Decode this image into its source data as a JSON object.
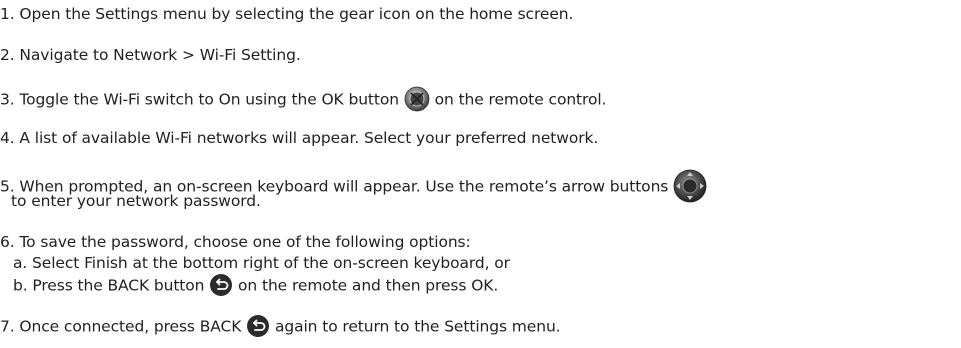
{
  "steps": {
    "s1": "1. Open the Settings menu by selecting the gear icon on the home screen.",
    "s2": "2. Navigate to Network > Wi-Fi Setting.",
    "s3a": "3. Toggle the Wi-Fi switch to On using the OK button",
    "s3b": "on the remote control.",
    "s4": "4. A list of available Wi-Fi networks will appear. Select your preferred network.",
    "s5a": "5. When prompted, an on-screen keyboard will appear. Use the remote’s arrow buttons",
    "s5b": "to enter your network password.",
    "s6": "6. To save the password, choose one of the following options:",
    "s6a": "a.  Select Finish at the bottom right of the on-screen keyboard, or",
    "s6b1": "b.  Press the BACK button",
    "s6b2": "on the remote and then press OK.",
    "s7a": "7. Once connected, press BACK",
    "s7b": "again to return to the Settings menu."
  },
  "icons": {
    "ok": "ok-button-icon",
    "arrows": "arrow-buttons-icon",
    "back": "back-button-icon"
  }
}
